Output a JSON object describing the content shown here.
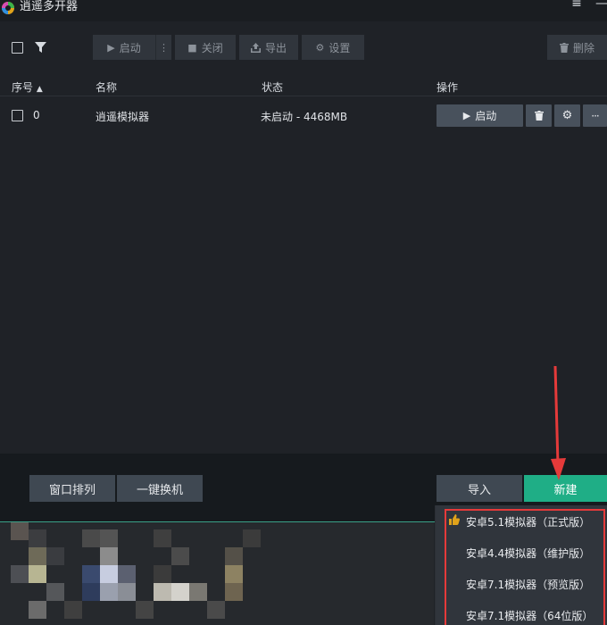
{
  "window": {
    "title": "逍遥多开器",
    "minimize_glyph": "—",
    "more_glyph": "≡"
  },
  "toolbar": {
    "start_label": "启动",
    "close_label": "关闭",
    "export_label": "导出",
    "settings_label": "设置",
    "delete_label": "删除"
  },
  "table": {
    "columns": [
      "序号",
      "名称",
      "状态",
      "操作"
    ],
    "rows": [
      {
        "index": "0",
        "name": "逍遥模拟器",
        "status": "未启动 - 4468MB",
        "start_label": "启动"
      }
    ]
  },
  "bottom": {
    "arrange_label": "窗口排列",
    "switch_label": "一键换机",
    "import_label": "导入",
    "new_label": "新建"
  },
  "new_menu": {
    "items": [
      "安卓5.1模拟器（正式版）",
      "安卓4.4模拟器（维护版）",
      "安卓7.1模拟器（预览版）",
      "安卓7.1模拟器（64位版）"
    ]
  },
  "colors": {
    "accent": "#1fae86",
    "annotation": "#e53a3a",
    "background": "#1f2227"
  }
}
